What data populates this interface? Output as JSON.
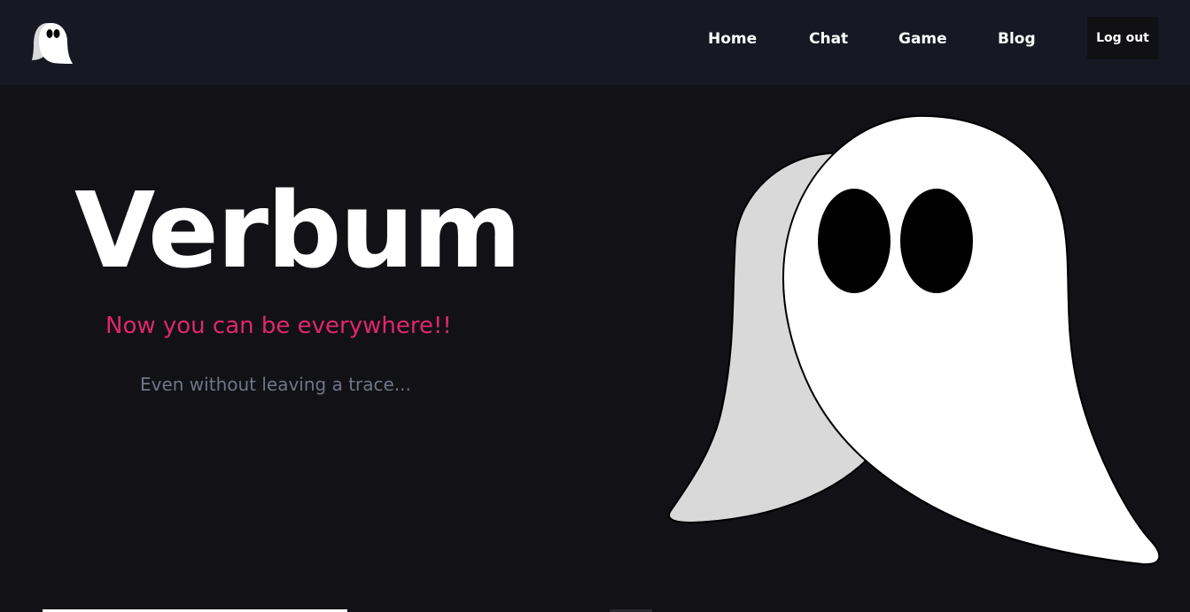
{
  "nav": {
    "logo_icon": "ghost-icon",
    "links": {
      "home": "Home",
      "chat": "Chat",
      "game": "Game",
      "blog": "Blog"
    },
    "logout_label": "Log out"
  },
  "hero": {
    "title": "Verbum",
    "tagline": "Now you can be everywhere!!",
    "subtitle": "Even without leaving a trace..."
  },
  "colors": {
    "background": "#111116",
    "navbar": "#171824",
    "accent": "#e0266e",
    "subtext": "#707687"
  },
  "illustration": {
    "icon": "ghost-illustration"
  }
}
